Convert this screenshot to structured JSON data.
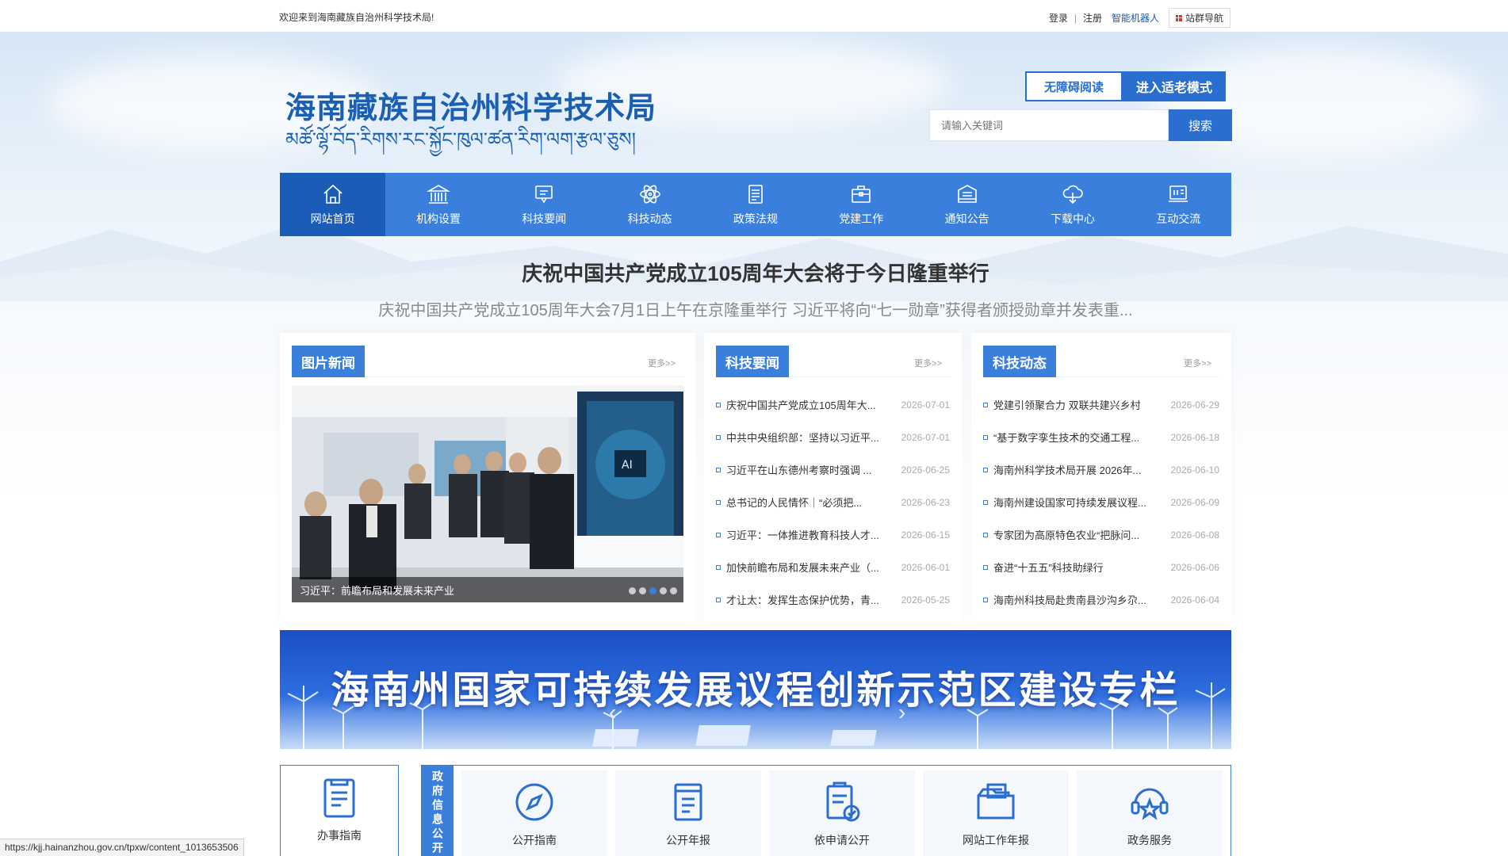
{
  "topbar": {
    "welcome": "欢迎来到海南藏族自治州科学技术局!",
    "login": "登录",
    "register": "注册",
    "robot": "智能机器人",
    "site_nav": "站群导航"
  },
  "header": {
    "title_cn": "海南藏族自治州科学技术局",
    "title_tibetan": "མཚོ་ལྷོ་བོད་རིགས་རང་སྐྱོང་ཁུལ་ཚན་རིག་ལག་རྩལ་ཅུས།",
    "accessibility_button": "无障碍阅读",
    "elderly_mode_button": "进入适老模式",
    "search_placeholder": "请输入关键词",
    "search_button": "搜索"
  },
  "nav": [
    {
      "label": "网站首页",
      "icon": "home-icon",
      "active": true
    },
    {
      "label": "机构设置",
      "icon": "building-icon"
    },
    {
      "label": "科技要闻",
      "icon": "message-icon"
    },
    {
      "label": "科技动态",
      "icon": "atom-icon"
    },
    {
      "label": "政策法规",
      "icon": "document-icon"
    },
    {
      "label": "党建工作",
      "icon": "briefcase-icon"
    },
    {
      "label": "通知公告",
      "icon": "inbox-icon"
    },
    {
      "label": "下载中心",
      "icon": "cloud-download-icon"
    },
    {
      "label": "互动交流",
      "icon": "chat-board-icon"
    }
  ],
  "headline": {
    "title": "庆祝中国共产党成立105周年大会将于今日隆重举行",
    "summary": "庆祝中国共产党成立105周年大会7月1日上午在京隆重举行 习近平将向“七一勋章”获得者颁授勋章并发表重..."
  },
  "picture_news": {
    "title": "图片新闻",
    "more": "更多>>",
    "caption": "习近平：前瞻布局和发展未来产业",
    "slide_count": 5,
    "active_slide": 3
  },
  "tech_news": {
    "title": "科技要闻",
    "more": "更多>>",
    "items": [
      {
        "title": "庆祝中国共产党成立105周年大...",
        "date": "2026-07-01"
      },
      {
        "title": "中共中央组织部：坚持以习近平...",
        "date": "2026-07-01"
      },
      {
        "title": "习近平在山东德州考察时强调 ...",
        "date": "2026-06-25"
      },
      {
        "title": "总书记的人民情怀｜“必须把...",
        "date": "2026-06-23"
      },
      {
        "title": "习近平：一体推进教育科技人才...",
        "date": "2026-06-15"
      },
      {
        "title": "加快前瞻布局和发展未来产业（...",
        "date": "2026-06-01"
      },
      {
        "title": "才让太：发挥生态保护优势，青...",
        "date": "2026-05-25"
      }
    ]
  },
  "tech_dynamics": {
    "title": "科技动态",
    "more": "更多>>",
    "items": [
      {
        "title": "党建引领聚合力 双联共建兴乡村",
        "date": "2026-06-29"
      },
      {
        "title": "“基于数字孪生技术的交通工程...",
        "date": "2026-06-18"
      },
      {
        "title": "海南州科学技术局开展 2026年...",
        "date": "2026-06-10"
      },
      {
        "title": "海南州建设国家可持续发展议程...",
        "date": "2026-06-09"
      },
      {
        "title": "专家团为高原特色农业“把脉问...",
        "date": "2026-06-08"
      },
      {
        "title": "奋进“十五五”科技助绿行",
        "date": "2026-06-06"
      },
      {
        "title": "海南州科技局赴贵南县沙沟乡尕...",
        "date": "2026-06-04"
      }
    ]
  },
  "banner": {
    "text": "海南州国家可持续发展议程创新示范区建设专栏",
    "prev": "‹",
    "next": "›"
  },
  "services": {
    "guide_label": "办事指南",
    "gov_tag": "政府信息公开",
    "items": [
      {
        "label": "公开指南",
        "icon": "compass-icon"
      },
      {
        "label": "公开年报",
        "icon": "report-icon"
      },
      {
        "label": "依申请公开",
        "icon": "clipboard-check-icon"
      },
      {
        "label": "网站工作年报",
        "icon": "folder-icon"
      },
      {
        "label": "政务服务",
        "icon": "headset-star-icon"
      }
    ]
  },
  "statusbar": {
    "url": "https://kjj.hainanzhou.gov.cn/tpxw/content_1013653506"
  },
  "colors": {
    "primary": "#3b7fdc",
    "primary_dark": "#1a5cb8",
    "title_blue": "#1a5fb4"
  }
}
